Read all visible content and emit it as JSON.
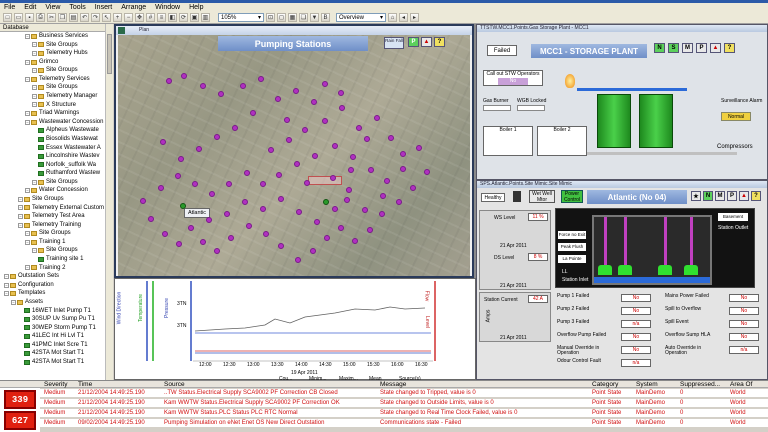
{
  "menu": [
    "File",
    "Edit",
    "View",
    "Tools",
    "Insert",
    "Arrange",
    "Window",
    "Help"
  ],
  "toolbar": {
    "zoom": "105%",
    "view": "Overview"
  },
  "sidebar": {
    "header": "Database",
    "items": [
      {
        "label": "Business Services",
        "indent": 3,
        "type": "folder"
      },
      {
        "label": "Site Groups",
        "indent": 4,
        "type": "folder"
      },
      {
        "label": "Telemetry Hubs",
        "indent": 4,
        "type": "folder"
      },
      {
        "label": "Grimco",
        "indent": 3,
        "type": "folder"
      },
      {
        "label": "Site Groups",
        "indent": 4,
        "type": "folder"
      },
      {
        "label": "Telemetry Services",
        "indent": 3,
        "type": "folder"
      },
      {
        "label": "Site Groups",
        "indent": 4,
        "type": "folder"
      },
      {
        "label": "Telemetry Manager",
        "indent": 4,
        "type": "folder"
      },
      {
        "label": "X Structure",
        "indent": 4,
        "type": "folder"
      },
      {
        "label": "Triad Warnings",
        "indent": 3,
        "type": "folder"
      },
      {
        "label": "Wastewater Concession",
        "indent": 3,
        "type": "folder"
      },
      {
        "label": "Alpheus Wastewate",
        "indent": 4,
        "type": "item"
      },
      {
        "label": "Biosolids Wastewat",
        "indent": 4,
        "type": "item"
      },
      {
        "label": "Essex Wastewater A",
        "indent": 4,
        "type": "item"
      },
      {
        "label": "Lincolnshire Wastev",
        "indent": 4,
        "type": "item"
      },
      {
        "label": "Norfolk_suffolk Wa",
        "indent": 4,
        "type": "item"
      },
      {
        "label": "Ruthamford Wastew",
        "indent": 4,
        "type": "item"
      },
      {
        "label": "Site Groups",
        "indent": 4,
        "type": "folder"
      },
      {
        "label": "Water Concession",
        "indent": 3,
        "type": "folder"
      },
      {
        "label": "Site Groups",
        "indent": 2,
        "type": "folder"
      },
      {
        "label": "Telemetry External Custom",
        "indent": 2,
        "type": "folder"
      },
      {
        "label": "Telemetry Test Area",
        "indent": 2,
        "type": "folder"
      },
      {
        "label": "Telemetry Training",
        "indent": 2,
        "type": "folder"
      },
      {
        "label": "Site Groups",
        "indent": 3,
        "type": "folder"
      },
      {
        "label": "Training 1",
        "indent": 3,
        "type": "folder"
      },
      {
        "label": "Site Groups",
        "indent": 4,
        "type": "folder"
      },
      {
        "label": "Training site 1",
        "indent": 4,
        "type": "item"
      },
      {
        "label": "Training 2",
        "indent": 3,
        "type": "folder"
      },
      {
        "label": "Outstation Sets",
        "indent": 0,
        "type": "folder"
      },
      {
        "label": "Configuration",
        "indent": 0,
        "type": "folder"
      },
      {
        "label": "Templates",
        "indent": 0,
        "type": "folder"
      },
      {
        "label": "Assets",
        "indent": 1,
        "type": "folder"
      },
      {
        "label": "16WET Inlet Pump T1",
        "indent": 2,
        "type": "item"
      },
      {
        "label": "30SUP Uv Sump Pu T1",
        "indent": 2,
        "type": "item"
      },
      {
        "label": "30WEP Storm Pump T1",
        "indent": 2,
        "type": "item"
      },
      {
        "label": "41LEC Int Hi Lvl T1",
        "indent": 2,
        "type": "item"
      },
      {
        "label": "41PMC Inlet Scre T1",
        "indent": 2,
        "type": "item"
      },
      {
        "label": "42STA Mot Start T1",
        "indent": 2,
        "type": "item"
      },
      {
        "label": "42STA Mot Start T1",
        "indent": 2,
        "type": "item"
      }
    ]
  },
  "pumping": {
    "win_title": "Plan",
    "header": "Pumping Stations",
    "rain_label": "Rain Fall",
    "sites": [
      "Atlantic",
      "Atlantic"
    ]
  },
  "mcc": {
    "win_title": "TTSTW.MCC1.Points.Gas Storage Plant - MCC1",
    "header": "MCC1 - STORAGE PLANT",
    "status": "Failed",
    "call_out": "Call out STW Operators",
    "call_value": "No",
    "gas_burner": "Gas Burner",
    "wgb_locked": "WGB Locked",
    "boiler1": "Boiler 1",
    "boiler2": "Boiler 2",
    "surv_alarm": "Surveillance Alarm",
    "surv_value": "Normal",
    "compressors": "Compressors",
    "buttons": [
      "N",
      "S",
      "M",
      "P"
    ]
  },
  "sps": {
    "win_title": "SPS.Atlantic.Points.Site Mimic.Site Mimic",
    "header": "Atlantic (No 04)",
    "healthy": "Healthy",
    "power_control": "Power Control",
    "wet_well": "Wet Well",
    "motor": "Mtor",
    "ws_level": "WS Level",
    "ws_value": "11 %",
    "date1": "21 Apr 2011",
    "ds_level": "DS Level",
    "ds_value": "8 %",
    "date2": "21 Apr 2011",
    "station_current": "Station Current",
    "current_value": "42 A",
    "date3": "21 Apr 2011",
    "amps": "Amps",
    "force_no_exit": "Force no Exit",
    "peak_flush": "Peak Flush",
    "la_pointe": "La Pointe",
    "ll": "LL",
    "station_inlet": "Station Inlet",
    "station_outlet": "Station Outlet",
    "basement": "Basement",
    "pump_fails": [
      {
        "label": "Pump 1 Failed",
        "value": "No"
      },
      {
        "label": "Pump 2 Failed",
        "value": "No"
      },
      {
        "label": "Pump 3 Failed",
        "value": "n/a"
      },
      {
        "label": "Overflow Pump Failed",
        "value": "No"
      },
      {
        "label": "Manual Override in Operation",
        "value": "No"
      },
      {
        "label": "Odour Control Fault",
        "value": "n/a"
      }
    ],
    "right_fails": [
      {
        "label": "Mains Power Failed",
        "value": "No"
      },
      {
        "label": "Spill to Overflow",
        "value": "No"
      },
      {
        "label": "Spill Event",
        "value": "No"
      },
      {
        "label": "Overflow Sump HLA",
        "value": "No"
      },
      {
        "label": "Auto Override in Operation",
        "value": "n/a"
      }
    ],
    "buttons": [
      "N",
      "M",
      "P"
    ]
  },
  "trend": {
    "y_labels": [
      "Wind Direction",
      "Temperature",
      "Pressure"
    ],
    "right_labels": [
      "Flow",
      "Level"
    ],
    "times": [
      "12:00",
      "12:30",
      "13:00",
      "13:30",
      "14:00",
      "14:30",
      "15:00",
      "15:30",
      "16:00",
      "16:30"
    ],
    "date": "19 Apr 2011",
    "ref1": "3TN",
    "ref2": "3TN",
    "footer": [
      "Cou...",
      "Minim...",
      "Maxim...",
      "Mean",
      "Source(s)"
    ]
  },
  "alarms": {
    "columns": [
      "Severity",
      "Time",
      "Source",
      "Message",
      "Category",
      "System",
      "Suppressed...",
      "Area Of Interest"
    ],
    "counters": [
      "339",
      "627"
    ],
    "rows": [
      {
        "severity": "Medium",
        "time": "21/12/2004 14:49:25.190",
        "source": "..TW Status.Electrical Supply SCA9002 PF Correction CB Closed",
        "message": "State changed to Tripped, value is 0",
        "category": "Point State",
        "system": "MainDemo",
        "suppressed": "0",
        "area": "World"
      },
      {
        "severity": "Medium",
        "time": "21/12/2004 14:49:25.190",
        "source": "Kam WWTW Status.Electrical Supply SCA9002 PF Correction OK",
        "message": "State changed to Outside Limits, value is 0",
        "category": "Point State",
        "system": "MainDemo",
        "suppressed": "0",
        "area": "World"
      },
      {
        "severity": "Medium",
        "time": "21/12/2004 14:49:25.190",
        "source": "Kam WWTW Status.PLC Status PLC RTC Normal",
        "message": "State changed to Real Time Clock Failed, value is 0",
        "category": "Point State",
        "system": "MainDemo",
        "suppressed": "0",
        "area": "World"
      },
      {
        "severity": "Medium",
        "time": "09/02/2004 14:49:25.190",
        "source": "Pumping Simulation on eNet Enet OS New Direct Outstation",
        "message": "Communications state - Failed",
        "category": "Point State",
        "system": "MainDemo",
        "suppressed": "0",
        "area": "World"
      }
    ]
  }
}
